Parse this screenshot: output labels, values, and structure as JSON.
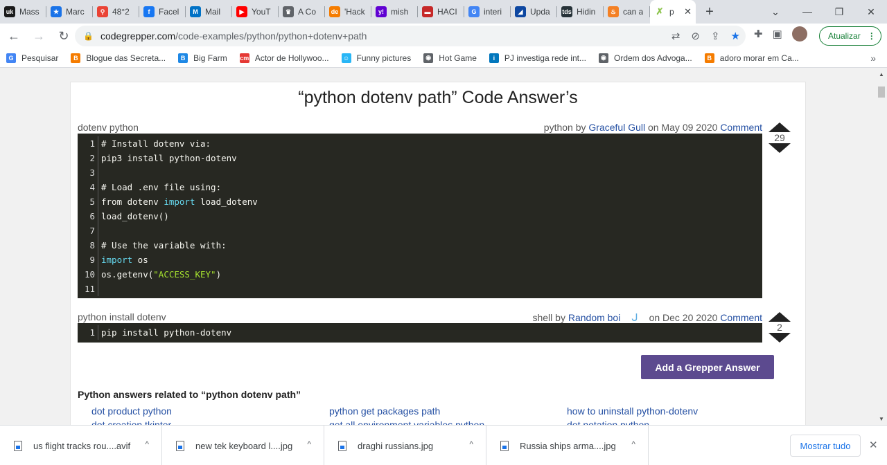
{
  "tabs": [
    {
      "title": "Mass",
      "favicon": "uk",
      "color": "#1a1a1a"
    },
    {
      "title": "Marc",
      "favicon": "★",
      "color": "#1a73e8"
    },
    {
      "title": "48°2",
      "favicon": "⚲",
      "color": "#ea4335"
    },
    {
      "title": "Facel",
      "favicon": "f",
      "color": "#1877f2"
    },
    {
      "title": "Mail",
      "favicon": "M",
      "color": "#0072c6"
    },
    {
      "title": "YouT",
      "favicon": "▶",
      "color": "#ff0000"
    },
    {
      "title": "A Co",
      "favicon": "♛",
      "color": "#5f6368"
    },
    {
      "title": "'Hack",
      "favicon": "de",
      "color": "#f57c00"
    },
    {
      "title": "mish",
      "favicon": "y!",
      "color": "#6001d2"
    },
    {
      "title": "HACI",
      "favicon": "▬",
      "color": "#c62828"
    },
    {
      "title": "interi",
      "favicon": "G",
      "color": "#4285f4"
    },
    {
      "title": "Upda",
      "favicon": "◢",
      "color": "#0d47a1"
    },
    {
      "title": "Hidin",
      "favicon": "tds",
      "color": "#263238"
    },
    {
      "title": "can a",
      "favicon": "♨",
      "color": "#f48024"
    }
  ],
  "active_tab": {
    "title": "p",
    "favicon": "✗",
    "color": "#8bc34a",
    "close": "✕"
  },
  "new_tab_icon": "+",
  "window_controls": {
    "chevron": "⌄",
    "minimize": "—",
    "restore": "❐",
    "close": "✕"
  },
  "nav": {
    "back": "←",
    "forward": "→",
    "reload": "↻"
  },
  "url": {
    "host": "codegrepper.com",
    "path": "/code-examples/python/python+dotenv+path",
    "lock": "🔒"
  },
  "omnibox_icons": {
    "translate": "⇄",
    "eye_off": "⊘",
    "share": "⇪",
    "star": "★"
  },
  "toolbar_icons": {
    "extensions": "✚",
    "sidepanel": "▣"
  },
  "update_button": {
    "label": "Atualizar",
    "menu": "⋮"
  },
  "bookmarks": [
    {
      "label": "Pesquisar",
      "icon": "G",
      "color": "#4285f4"
    },
    {
      "label": "Blogue das Secreta...",
      "icon": "B",
      "color": "#f57c00"
    },
    {
      "label": "Big Farm",
      "icon": "B",
      "color": "#1e88e5"
    },
    {
      "label": "Actor de Hollywoo...",
      "icon": "cm",
      "color": "#e53935"
    },
    {
      "label": "Funny pictures",
      "icon": "☺",
      "color": "#29b6f6"
    },
    {
      "label": "Hot Game",
      "icon": "◉",
      "color": "#5f6368"
    },
    {
      "label": "PJ investiga rede int...",
      "icon": "i",
      "color": "#0277bd"
    },
    {
      "label": "Ordem dos Advoga...",
      "icon": "◉",
      "color": "#5f6368"
    },
    {
      "label": "adoro morar em Ca...",
      "icon": "B",
      "color": "#f57c00"
    }
  ],
  "bookmarks_more": "»",
  "page": {
    "title": "“python dotenv path” Code Answer’s",
    "answer1": {
      "label": "dotenv python",
      "lang": "python",
      "by": "by",
      "author": "Graceful Gull",
      "date": "on May 09 2020",
      "comment": "Comment",
      "votes": "29",
      "lines": [
        "# Install dotenv via:",
        "pip3 install python-dotenv",
        "",
        "# Load .env file using:",
        "from dotenv import load_dotenv",
        "load_dotenv()",
        "",
        "# Use the variable with:",
        "import os",
        "os.getenv(\"ACCESS_KEY\")",
        ""
      ]
    },
    "answer2": {
      "label": "python install dotenv",
      "lang": "shell",
      "by": "by",
      "author": "Random boi",
      "date": "on Dec 20 2020",
      "comment": "Comment",
      "votes": "2",
      "lines": [
        "pip install python-dotenv"
      ]
    },
    "add_answer": "Add a Grepper Answer",
    "related_title": "Python answers related to “python dotenv path”",
    "related": [
      "dot product python",
      "python get packages path",
      "how to uninstall python-dotenv",
      "dot creation tkinter",
      "get all environment variables python",
      "dot notation python"
    ]
  },
  "downloads": [
    {
      "name": "us flight tracks rou....avif"
    },
    {
      "name": "new tek keyboard l....jpg"
    },
    {
      "name": "draghi russians.jpg"
    },
    {
      "name": "Russia ships arma....jpg"
    }
  ],
  "download_chevron": "^",
  "show_all": "Mostrar tudo",
  "downloads_close": "✕"
}
